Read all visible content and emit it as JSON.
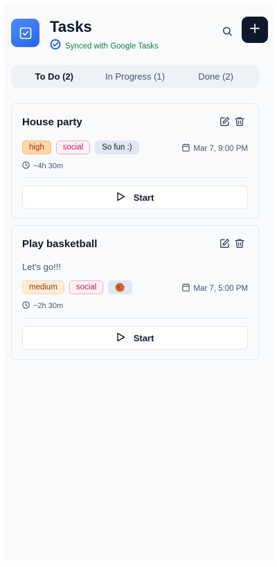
{
  "header": {
    "title": "Tasks",
    "sync_status": "Synced with Google Tasks",
    "app_icon": "check-square-icon",
    "search_icon": "search-icon",
    "add_icon": "plus-icon",
    "accent_color": "#2563eb",
    "sync_color": "#15803d"
  },
  "tabs": [
    {
      "label": "To Do (2)",
      "active": true
    },
    {
      "label": "In Progress (1)",
      "active": false
    },
    {
      "label": "Done (2)",
      "active": false
    }
  ],
  "tasks": [
    {
      "title": "House party",
      "description": "",
      "tags": [
        "high",
        "social",
        "So fun :)"
      ],
      "date": "Mar 7, 9:00 PM",
      "duration": "~4h 30m",
      "start_label": "Start"
    },
    {
      "title": "Play basketball",
      "description": "Let's go!!!",
      "tags": [
        "medium",
        "social",
        "🏀"
      ],
      "date": "Mar 7, 5:00 PM",
      "duration": "~2h 30m",
      "start_label": "Start"
    }
  ]
}
